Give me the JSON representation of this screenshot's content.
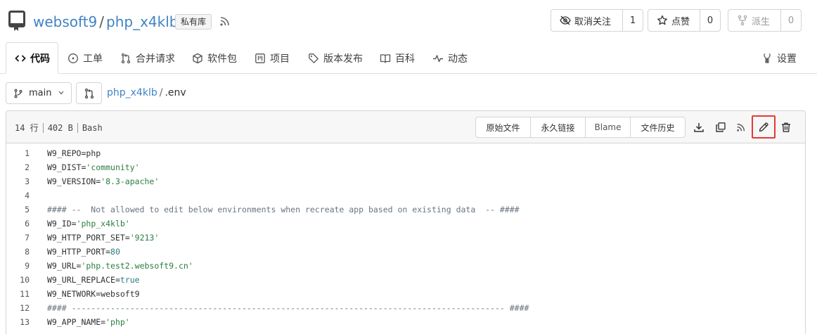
{
  "repo": {
    "owner": "websoft9",
    "separator": "/",
    "name": "php_x4klb",
    "private_badge": "私有库",
    "icon": "repo-icon",
    "rss_icon": "rss-icon"
  },
  "actions": {
    "unwatch": {
      "label": "取消关注",
      "count": "1",
      "icon": "eye-slash-icon"
    },
    "star": {
      "label": "点赞",
      "count": "0",
      "icon": "star-icon"
    },
    "fork": {
      "label": "派生",
      "count": "0",
      "icon": "fork-icon",
      "disabled": true
    }
  },
  "tabs": [
    {
      "label": "代码",
      "icon": "code-icon",
      "active": true
    },
    {
      "label": "工单",
      "icon": "issue-icon"
    },
    {
      "label": "合并请求",
      "icon": "pull-request-icon"
    },
    {
      "label": "软件包",
      "icon": "package-icon"
    },
    {
      "label": "项目",
      "icon": "project-icon"
    },
    {
      "label": "版本发布",
      "icon": "tag-icon"
    },
    {
      "label": "百科",
      "icon": "book-icon"
    },
    {
      "label": "动态",
      "icon": "pulse-icon"
    },
    {
      "label": "设置",
      "icon": "tools-icon"
    }
  ],
  "path_bar": {
    "branch": "main",
    "repo_link": "php_x4klb",
    "separator": "/",
    "file": ".env"
  },
  "file": {
    "lines": "14 行",
    "size": "402 B",
    "language": "Bash",
    "buttons": [
      "原始文件",
      "永久链接",
      "Blame",
      "文件历史"
    ],
    "tool_icons": [
      "download-icon",
      "copy-icon",
      "rss-icon",
      "edit-icon",
      "trash-icon"
    ],
    "code": [
      {
        "n": "1",
        "key": "W9_REPO",
        "eq": "=",
        "val": "php",
        "type": "plain"
      },
      {
        "n": "2",
        "key": "W9_DIST",
        "eq": "=",
        "val": "'community'",
        "type": "string"
      },
      {
        "n": "3",
        "key": "W9_VERSION",
        "eq": "=",
        "val": "'8.3-apache'",
        "type": "string"
      },
      {
        "n": "4",
        "key": "",
        "eq": "",
        "val": "",
        "type": "empty"
      },
      {
        "n": "5",
        "text": "#### --  Not allowed to edit below environments when recreate app based on existing data  -- ####",
        "type": "comment"
      },
      {
        "n": "6",
        "key": "W9_ID",
        "eq": "=",
        "val": "'php_x4klb'",
        "type": "string"
      },
      {
        "n": "7",
        "key": "W9_HTTP_PORT_SET",
        "eq": "=",
        "val": "'9213'",
        "type": "string"
      },
      {
        "n": "8",
        "key": "W9_HTTP_PORT",
        "eq": "=",
        "val": "80",
        "type": "keyword"
      },
      {
        "n": "9",
        "key": "W9_URL",
        "eq": "=",
        "val": "'php.test2.websoft9.cn'",
        "type": "string"
      },
      {
        "n": "10",
        "key": "W9_URL_REPLACE",
        "eq": "=",
        "val": "true",
        "type": "keyword"
      },
      {
        "n": "11",
        "key": "W9_NETWORK",
        "eq": "=",
        "val": "websoft9",
        "type": "plain"
      },
      {
        "n": "12",
        "text": "#### ----------------------------------------------------------------------------------------- ####",
        "type": "comment"
      },
      {
        "n": "13",
        "key": "W9_APP_NAME",
        "eq": "=",
        "val": "'php'",
        "type": "string"
      }
    ]
  },
  "colors": {
    "link": "#4183c4",
    "highlight": "#e53935",
    "string": "#2a7f3f",
    "keyword": "#2c7a86"
  }
}
